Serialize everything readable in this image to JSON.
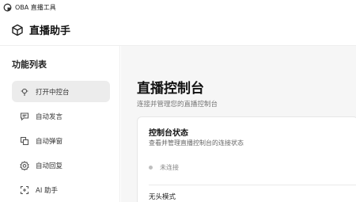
{
  "window": {
    "title": "OBA 直播工具"
  },
  "header": {
    "app_name": "直播助手",
    "logo_icon": "cube-icon"
  },
  "sidebar": {
    "section_title": "功能列表",
    "items": [
      {
        "label": "打开中控台",
        "icon": "pin-icon",
        "active": true
      },
      {
        "label": "自动发言",
        "icon": "chat-icon",
        "active": false
      },
      {
        "label": "自动弹窗",
        "icon": "popup-icon",
        "active": false
      },
      {
        "label": "自动回复",
        "icon": "gear-icon",
        "active": false
      },
      {
        "label": "AI 助手",
        "icon": "ai-icon",
        "active": false
      }
    ]
  },
  "main": {
    "title": "直播控制台",
    "subtitle": "连接并管理您的直播控制台",
    "card": {
      "title": "控制台状态",
      "description": "查看并管理直播控制台的连接状态",
      "status": "未连接",
      "status_color": "#bfbfbf",
      "headless_label": "无头模式"
    }
  },
  "colors": {
    "sidebar_active_bg": "#ececec",
    "main_bg": "#f6f6f6"
  }
}
